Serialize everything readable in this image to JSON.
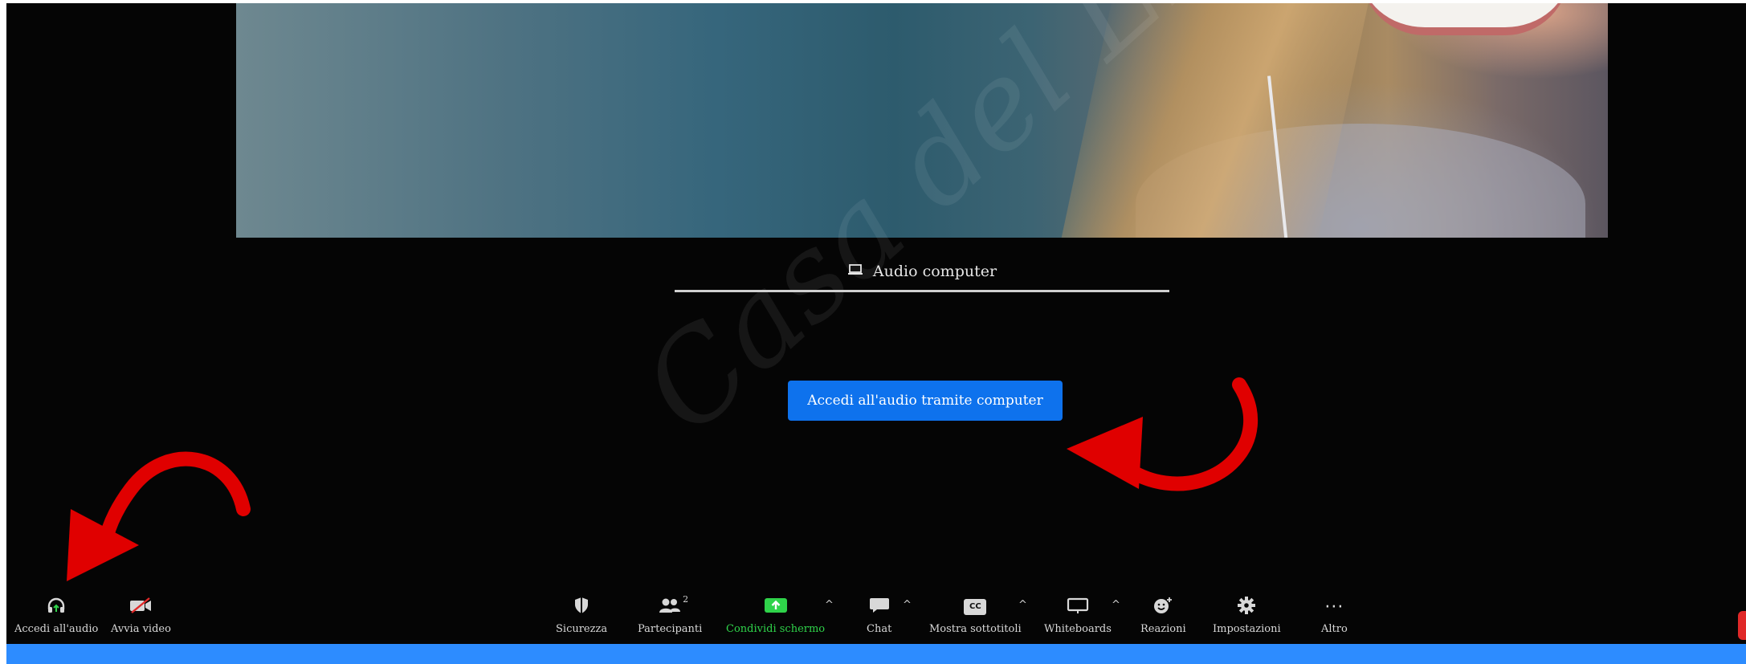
{
  "audio_panel": {
    "tab_label": "Audio computer",
    "join_button_label": "Accedi all'audio tramite computer"
  },
  "watermark": "Casa del Lievito",
  "toolbar": {
    "join_audio": "Accedi all'audio",
    "start_video": "Avvia video",
    "security": "Sicurezza",
    "participants": "Partecipanti",
    "participants_count": "2",
    "share_screen": "Condividi schermo",
    "chat": "Chat",
    "captions": "Mostra sottotitoli",
    "captions_icon_text": "CC",
    "whiteboards": "Whiteboards",
    "reactions": "Reazioni",
    "settings": "Impostazioni",
    "more": "Altro",
    "more_icon_text": "···"
  },
  "colors": {
    "accent_blue": "#0e72ed",
    "bottom_bar": "#2d8cff",
    "share_green": "#2fd34a",
    "annotation_red": "#e00000",
    "end_red": "#e02828"
  }
}
